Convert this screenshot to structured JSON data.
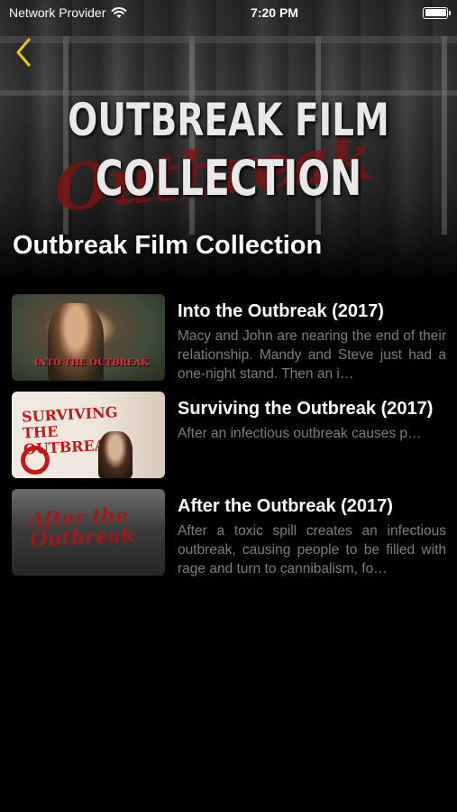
{
  "status_bar": {
    "carrier": "Network Provider",
    "time": "7:20 PM",
    "battery_level": 1.0
  },
  "hero": {
    "logo_line_1": "OUTBREAK FILM",
    "logo_line_2": "COLLECTION",
    "scrawl_text": "Outbreak",
    "title": "Outbreak Film Collection"
  },
  "colors": {
    "background": "#000000",
    "accent_back_chevron": "#f0c419",
    "title_text": "#ffffff",
    "description_text": "#7d7d7d"
  },
  "films": [
    {
      "title": "Into the Outbreak (2017)",
      "description": "Macy and John are nearing the end of their relationship. Mandy and Steve just had a one-night stand. Then an i…",
      "thumbnail_text": "INTO THE OUTBREAK"
    },
    {
      "title": "Surviving the Outbreak (2017)",
      "description": "After an infectious outbreak causes p…",
      "thumbnail_text": "SURVIVING THE OUTBREAK"
    },
    {
      "title": "After the Outbreak (2017)",
      "description": "After a toxic spill creates an infectious outbreak, causing people to be filled with rage and turn to cannibalism, fo…",
      "thumbnail_text": "After the Outbreak"
    }
  ]
}
